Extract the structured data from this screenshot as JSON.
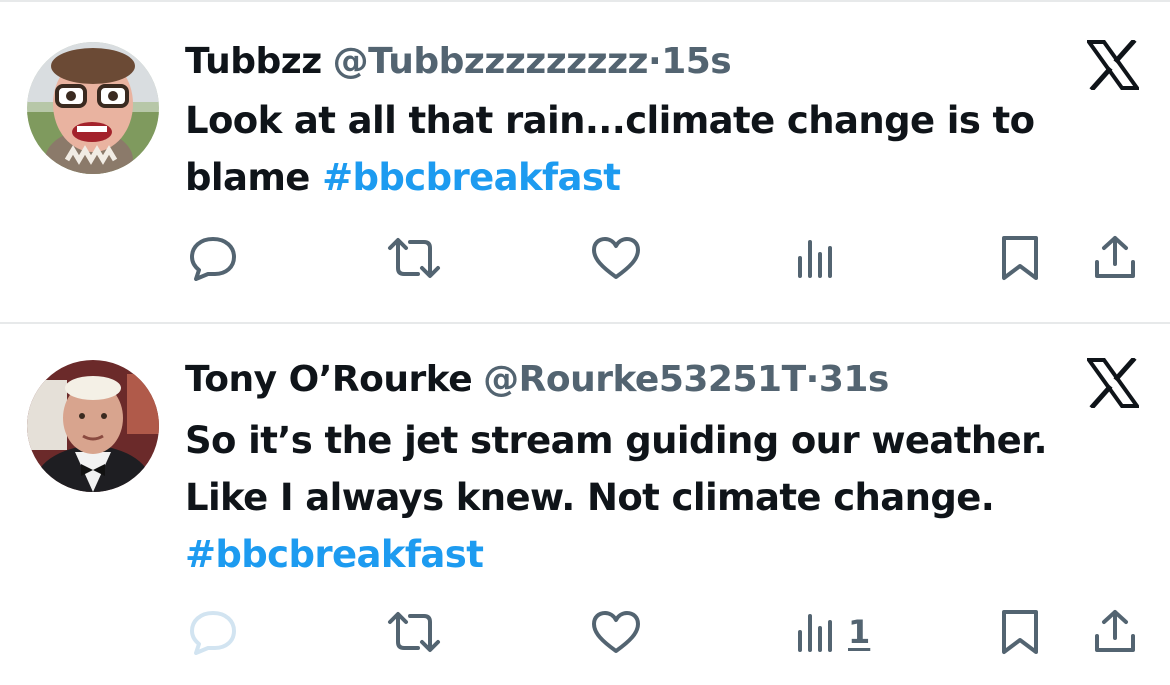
{
  "tweets": [
    {
      "name": "Tubbzz",
      "handle": "@Tubbzzzzzzzzz",
      "separator": "·",
      "time": "15s",
      "text_lines": [
        "Look at all that rain...climate change is to",
        "blame "
      ],
      "hashtag": "#bbcbreakfast",
      "views_count": "",
      "reply_disabled": false
    },
    {
      "name": "Tony O’Rourke",
      "handle": "@Rourke53251T",
      "separator": "·",
      "time": "31s",
      "text_lines": [
        "So it’s the jet stream guiding our weather.",
        "Like I always knew. Not climate change."
      ],
      "hashtag": "#bbcbreakfast",
      "views_count": "1",
      "reply_disabled": true
    }
  ],
  "icons": {
    "brand": "x-logo-icon",
    "reply": "reply-icon",
    "retweet": "retweet-icon",
    "like": "like-icon",
    "views": "views-icon",
    "bookmark": "bookmark-icon",
    "share": "share-icon"
  },
  "colors": {
    "text": "#0f1419",
    "secondary": "#536471",
    "link": "#1d9bf0",
    "divider": "#e7e9ea",
    "disabled": "#d2e4f1"
  }
}
